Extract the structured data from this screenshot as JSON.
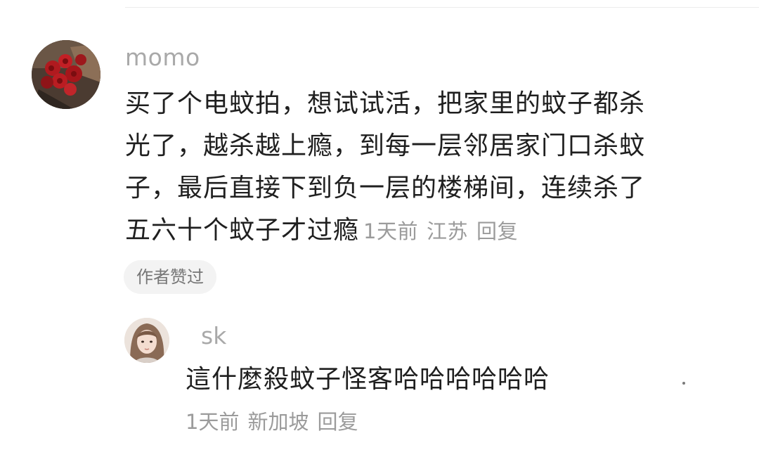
{
  "main_comment": {
    "username": "momo",
    "text": "买了个电蚊拍，想试试活，把家里的蚊子都杀光了，越杀越上瘾，到每一层邻居家门口杀蚊子，最后直接下到负一层的楼梯间，连续杀了五六十个蚊子才过瘾",
    "time": "1天前",
    "location": "江苏",
    "reply_label": "回复",
    "badge": "作者赞过"
  },
  "reply_comment": {
    "username": "sk",
    "text": "這什麼殺蚊子怪客哈哈哈哈哈哈",
    "time": "1天前",
    "location": "新加坡",
    "reply_label": "回复"
  },
  "colors": {
    "username": "#a9a9a9",
    "body_text": "#1f1f1f",
    "meta_text": "#9b9b9b",
    "badge_bg": "#f3f3f3"
  }
}
